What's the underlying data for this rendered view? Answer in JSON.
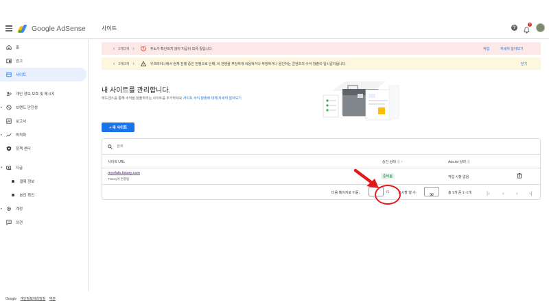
{
  "app": {
    "brand": "Google AdSense",
    "page_heading": "사이트",
    "notification_count": "1"
  },
  "sidebar": {
    "items": [
      {
        "label": "홈"
      },
      {
        "label": "광고"
      },
      {
        "label": "사이트"
      },
      {
        "label": "개인 정보 보호 및 메시지"
      },
      {
        "label": "브랜드 안전성"
      },
      {
        "label": "보고서"
      },
      {
        "label": "최적화"
      },
      {
        "label": "정책 센터"
      },
      {
        "label": "지급"
      },
      {
        "label": "결제 정보"
      },
      {
        "label": "본인 확인"
      },
      {
        "label": "계정"
      },
      {
        "label": "의견"
      }
    ],
    "footer_brand": "Google",
    "footer_privacy": "개인정보처리방침",
    "footer_terms": "약관"
  },
  "alerts": [
    {
      "pager": "2개/2개",
      "message": "주소가 확인되지 않아 지급이 보류 중입니다",
      "action1": "작업",
      "action2": "자세히 알아보기",
      "color": "#fce8e6"
    },
    {
      "pager": "2개/2개",
      "message": "우크라이나에서 현재 진행 중인 전쟁으로 인해, 이 전쟁을 부당하게 이용하거나 부정하거나 용인하는 콘텐츠의 수익 창출이 일시중지됩니다.",
      "action1": "닫기",
      "color": "#fef7e0"
    }
  ],
  "main": {
    "title": "내 사이트를 관리합니다.",
    "subtitle": "애드센스를 통해 수익을 창출하려는 사이트를 추가하세요",
    "subtitle_link": "사이트 수익 창출에 대해 자세히 알아보기",
    "new_site_button": "+ 새 사이트"
  },
  "table": {
    "search_placeholder": "검색",
    "columns": {
      "url": "사이트 URL",
      "approval": "승인 상태",
      "ads_txt": "Ads.txt 상태"
    },
    "rows": [
      {
        "url": "myofats.tistory.com",
        "sub": "Tistory에 연결됨",
        "approval": "준비됨",
        "ads_txt": "작업 사항 없음"
      }
    ],
    "pager": {
      "go_to_page": "다음 페이지로 이동:",
      "page_total": "/1",
      "rows_per_page_label": "표시할 행 수:",
      "rows_per_page": "50",
      "range": "총 1개 중 1~1개"
    }
  },
  "colors": {
    "accent": "#1a73e8",
    "annotation": "#e01b1b"
  }
}
